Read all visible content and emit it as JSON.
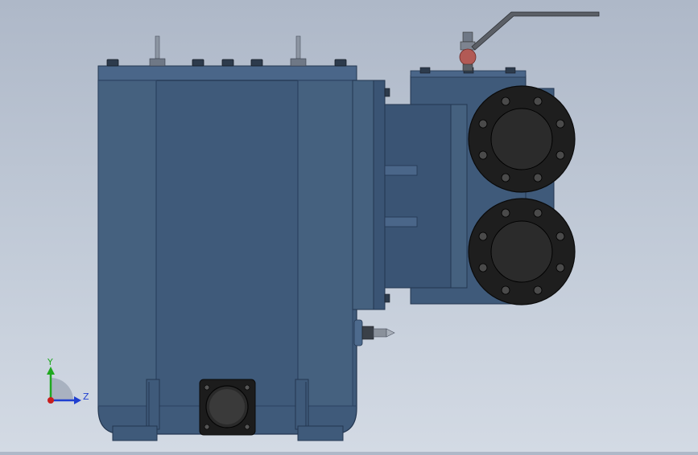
{
  "viewport": {
    "background_top": "#aeb8c8",
    "background_bottom": "#d3dae4",
    "model_color": "#3f5a7a",
    "model_dark": "#2c4360",
    "model_light": "#4d6a8d",
    "flange_color": "#1e1e1e",
    "valve_handle_color": "#5b5f66",
    "valve_ball_color": "#b25a55"
  },
  "triad": {
    "y_label": "Y",
    "z_label": "Z",
    "y_color": "#1fa81f",
    "z_color": "#1f3fd0",
    "x_color": "#c81e1e",
    "origin_color": "#7d8898"
  }
}
